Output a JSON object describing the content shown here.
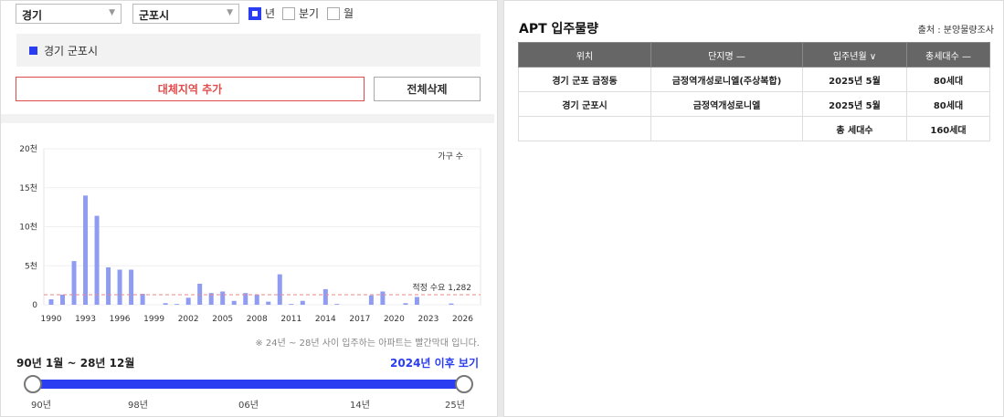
{
  "filters": {
    "province": "경기",
    "city": "군포시",
    "period_options": [
      {
        "label": "년",
        "checked": true
      },
      {
        "label": "분기",
        "checked": false
      },
      {
        "label": "월",
        "checked": false
      }
    ]
  },
  "selected_region": "경기 군포시",
  "buttons": {
    "add_alt_region": "대체지역 추가",
    "delete_all": "전체삭제"
  },
  "chart_data": {
    "type": "bar",
    "ylabel": "가구 수",
    "y_ticks": [
      "0",
      "5천",
      "10천",
      "15천",
      "20천"
    ],
    "ylim": [
      0,
      20000
    ],
    "x_tick_labels": [
      "1990",
      "1993",
      "1996",
      "1999",
      "2002",
      "2005",
      "2008",
      "2011",
      "2014",
      "2017",
      "2020",
      "2023",
      "2026"
    ],
    "x": [
      1990,
      1991,
      1992,
      1993,
      1994,
      1995,
      1996,
      1997,
      1998,
      1999,
      2000,
      2001,
      2002,
      2003,
      2004,
      2005,
      2006,
      2007,
      2008,
      2009,
      2010,
      2011,
      2012,
      2013,
      2014,
      2015,
      2016,
      2017,
      2018,
      2019,
      2020,
      2021,
      2022,
      2023,
      2024,
      2025,
      2026
    ],
    "values": [
      700,
      1300,
      5600,
      14000,
      11400,
      4800,
      4500,
      4500,
      1400,
      0,
      200,
      100,
      900,
      2700,
      1500,
      1700,
      500,
      1500,
      1300,
      400,
      3900,
      100,
      500,
      0,
      2000,
      100,
      0,
      0,
      1200,
      1700,
      0,
      200,
      1000,
      0,
      0,
      160,
      0
    ],
    "reference_line": {
      "label": "적정 수요 1,282",
      "value": 1282,
      "color": "#e88a8a"
    },
    "bar_color": "#8f9cf2",
    "grid": true
  },
  "note": "※ 24년 ~ 28년 사이 입주하는 아파트는 빨간막대 입니다.",
  "range": {
    "label": "90년 1월 ~ 28년 12월",
    "link": "2024년 이후 보기",
    "ticks": [
      "90년",
      "98년",
      "06년",
      "14년",
      "25년"
    ]
  },
  "right_panel": {
    "title": "APT 입주물량",
    "source": "출처 : 분양물량조사",
    "columns": [
      "위치",
      "단지명 —",
      "입주년월 ∨",
      "총세대수 —"
    ],
    "rows": [
      [
        "경기 군포 금정동",
        "금정역개성로니엘(주상복합)",
        "2025년 5월",
        "80세대"
      ],
      [
        "경기 군포시",
        "금정역개성로니엘",
        "2025년 5월",
        "80세대"
      ],
      [
        "",
        "",
        "총 세대수",
        "160세대"
      ]
    ]
  }
}
